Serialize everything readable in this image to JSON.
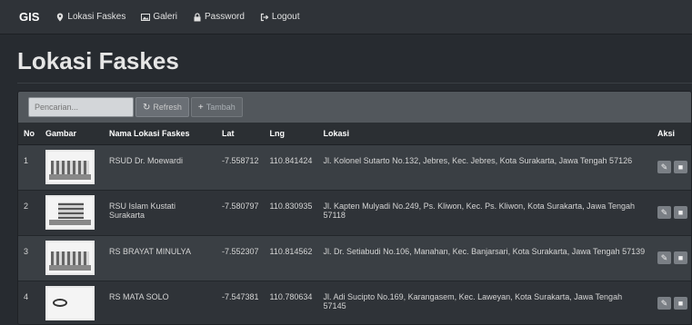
{
  "navbar": {
    "brand": "GIS",
    "items": [
      {
        "label": "Lokasi Faskes",
        "icon": "map-marker-icon"
      },
      {
        "label": "Galeri",
        "icon": "picture-icon"
      },
      {
        "label": "Password",
        "icon": "lock-icon"
      },
      {
        "label": "Logout",
        "icon": "logout-icon"
      }
    ]
  },
  "page": {
    "title": "Lokasi Faskes"
  },
  "toolbar": {
    "search_placeholder": "Pencarian...",
    "refresh_label": "Refresh",
    "add_label": "Tambah"
  },
  "table": {
    "headers": [
      "No",
      "Gambar",
      "Nama Lokasi Faskes",
      "Lat",
      "Lng",
      "Lokasi",
      "Aksi"
    ],
    "rows": [
      {
        "no": "1",
        "nama": "RSUD Dr. Moewardi",
        "lat": "-7.558712",
        "lng": "110.841424",
        "lokasi": "Jl. Kolonel Sutarto No.132, Jebres, Kec. Jebres, Kota Surakarta, Jawa Tengah 57126"
      },
      {
        "no": "2",
        "nama": "RSU Islam Kustati Surakarta",
        "lat": "-7.580797",
        "lng": "110.830935",
        "lokasi": "Jl. Kapten Mulyadi No.249, Ps. Kliwon, Kec. Ps. Kliwon, Kota Surakarta, Jawa Tengah 57118"
      },
      {
        "no": "3",
        "nama": "RS BRAYAT MINULYA",
        "lat": "-7.552307",
        "lng": "110.814562",
        "lokasi": "Jl. Dr. Setiabudi No.106, Manahan, Kec. Banjarsari, Kota Surakarta, Jawa Tengah 57139"
      },
      {
        "no": "4",
        "nama": "RS MATA SOLO",
        "lat": "-7.547381",
        "lng": "110.780634",
        "lokasi": "Jl. Adi Sucipto No.169, Karangasem, Kec. Laweyan, Kota Surakarta, Jawa Tengah 57145"
      }
    ]
  }
}
